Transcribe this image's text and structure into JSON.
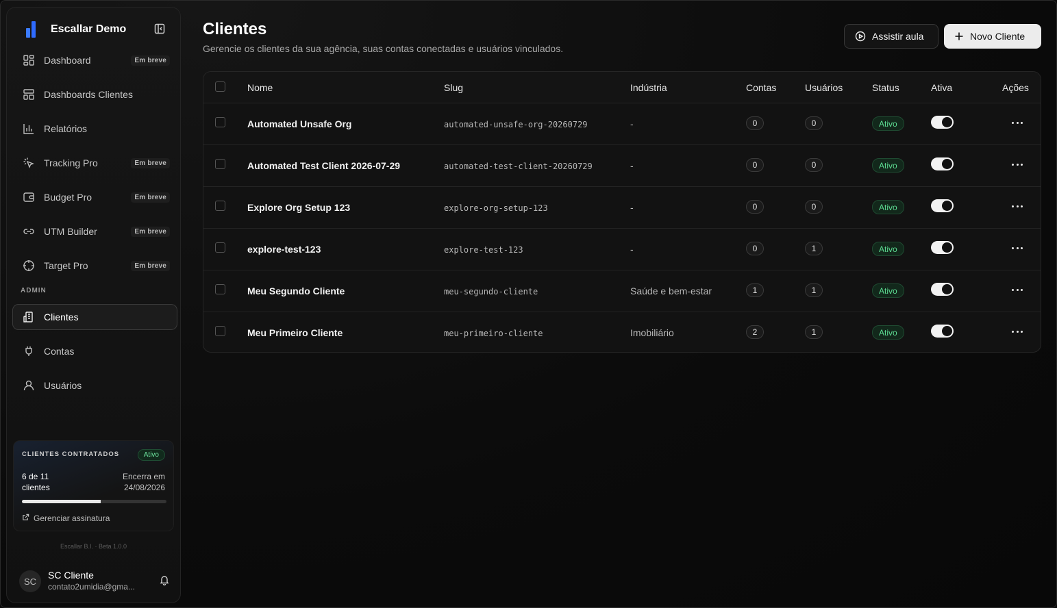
{
  "brand": {
    "name": "Escallar Demo"
  },
  "nav": {
    "items": [
      {
        "label": "Dashboard",
        "badge": "Em breve",
        "icon": "layout-grid-icon"
      },
      {
        "label": "Dashboards Clientes",
        "badge": "",
        "icon": "layout-dashboard-icon"
      },
      {
        "label": "Relatórios",
        "badge": "",
        "icon": "bar-chart-icon"
      },
      {
        "label": "Tracking Pro",
        "badge": "Em breve",
        "icon": "cursor-click-icon"
      },
      {
        "label": "Budget Pro",
        "badge": "Em breve",
        "icon": "wallet-icon"
      },
      {
        "label": "UTM Builder",
        "badge": "Em breve",
        "icon": "link-icon"
      },
      {
        "label": "Target Pro",
        "badge": "Em breve",
        "icon": "crosshair-icon"
      }
    ],
    "admin_label": "ADMIN",
    "admin_items": [
      {
        "label": "Clientes",
        "icon": "building-icon",
        "active": true
      },
      {
        "label": "Contas",
        "icon": "plug-icon",
        "active": false
      },
      {
        "label": "Usuários",
        "icon": "user-icon",
        "active": false
      }
    ]
  },
  "plan": {
    "title": "CLIENTES CONTRATADOS",
    "status": "Ativo",
    "count": "6 de 11 clientes",
    "expire_label": "Encerra em",
    "expire_date": "24/08/2026",
    "progress": 0.545,
    "manage_link": "Gerenciar assinatura"
  },
  "version": "Escallar B.I. · Beta 1.0.0",
  "user": {
    "initials": "SC",
    "name": "SC Cliente",
    "email": "contato2umidia@gma..."
  },
  "header": {
    "title": "Clientes",
    "subtitle": "Gerencie os clientes da sua agência, suas contas conectadas e usuários vinculados.",
    "watch_button": "Assistir aula",
    "new_button": "Novo Cliente"
  },
  "table": {
    "columns": [
      "Nome",
      "Slug",
      "Indústria",
      "Contas",
      "Usuários",
      "Status",
      "Ativa",
      "Ações"
    ],
    "rows": [
      {
        "name": "Automated Unsafe Org",
        "slug": "automated-unsafe-org-20260729",
        "industry": "-",
        "contas": "0",
        "usuarios": "0",
        "status": "Ativo"
      },
      {
        "name": "Automated Test Client 2026-07-29",
        "slug": "automated-test-client-20260729",
        "industry": "-",
        "contas": "0",
        "usuarios": "0",
        "status": "Ativo"
      },
      {
        "name": "Explore Org Setup 123",
        "slug": "explore-org-setup-123",
        "industry": "-",
        "contas": "0",
        "usuarios": "0",
        "status": "Ativo"
      },
      {
        "name": "explore-test-123",
        "slug": "explore-test-123",
        "industry": "-",
        "contas": "0",
        "usuarios": "1",
        "status": "Ativo"
      },
      {
        "name": "Meu Segundo Cliente",
        "slug": "meu-segundo-cliente",
        "industry": "Saúde e bem-estar",
        "contas": "1",
        "usuarios": "1",
        "status": "Ativo"
      },
      {
        "name": "Meu Primeiro Cliente",
        "slug": "meu-primeiro-cliente",
        "industry": "Imobiliário",
        "contas": "2",
        "usuarios": "1",
        "status": "Ativo"
      }
    ]
  },
  "colors": {
    "accent_blue": "#2f6bff",
    "status_green": "#5ddc92",
    "background": "#0a0a0a"
  }
}
